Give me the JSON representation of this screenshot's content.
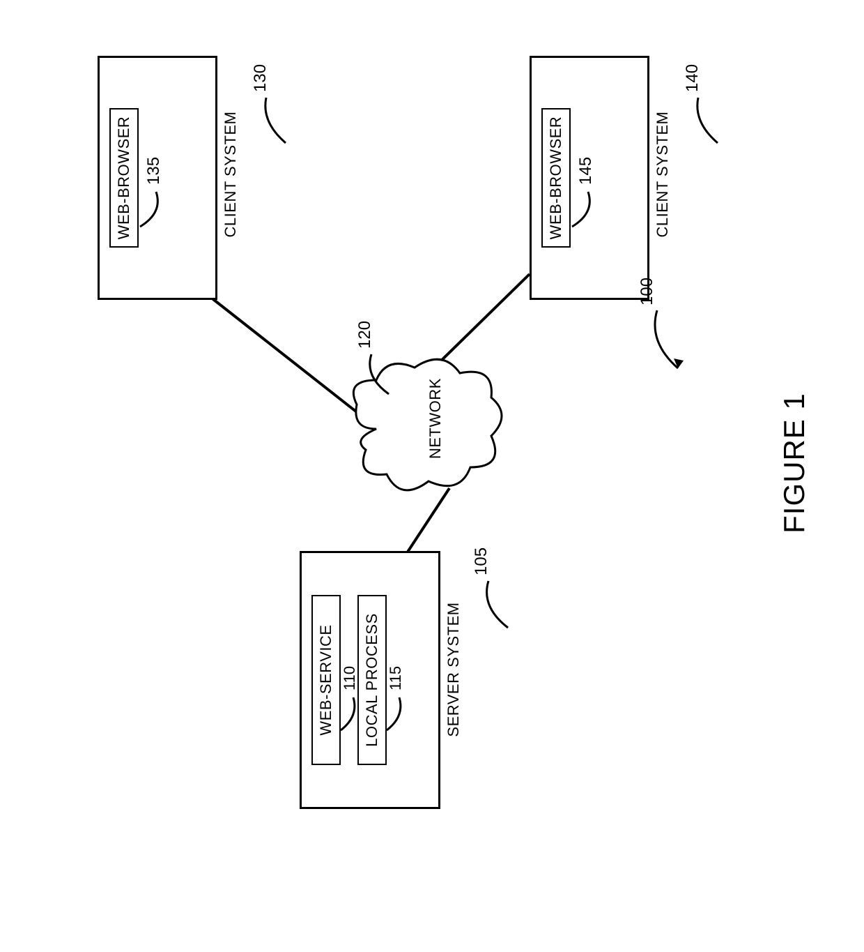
{
  "figure_caption": "FIGURE 1",
  "refs": {
    "system": "100",
    "server": "105",
    "webservice": "110",
    "localprocess": "115",
    "network": "120",
    "client_left": "130",
    "browser_left": "135",
    "client_right": "140",
    "browser_right": "145"
  },
  "labels": {
    "client_system": "CLIENT SYSTEM",
    "server_system": "SERVER SYSTEM",
    "web_browser": "WEB-BROWSER",
    "web_service": "WEB-SERVICE",
    "local_process": "LOCAL PROCESS",
    "network": "NETWORK"
  }
}
